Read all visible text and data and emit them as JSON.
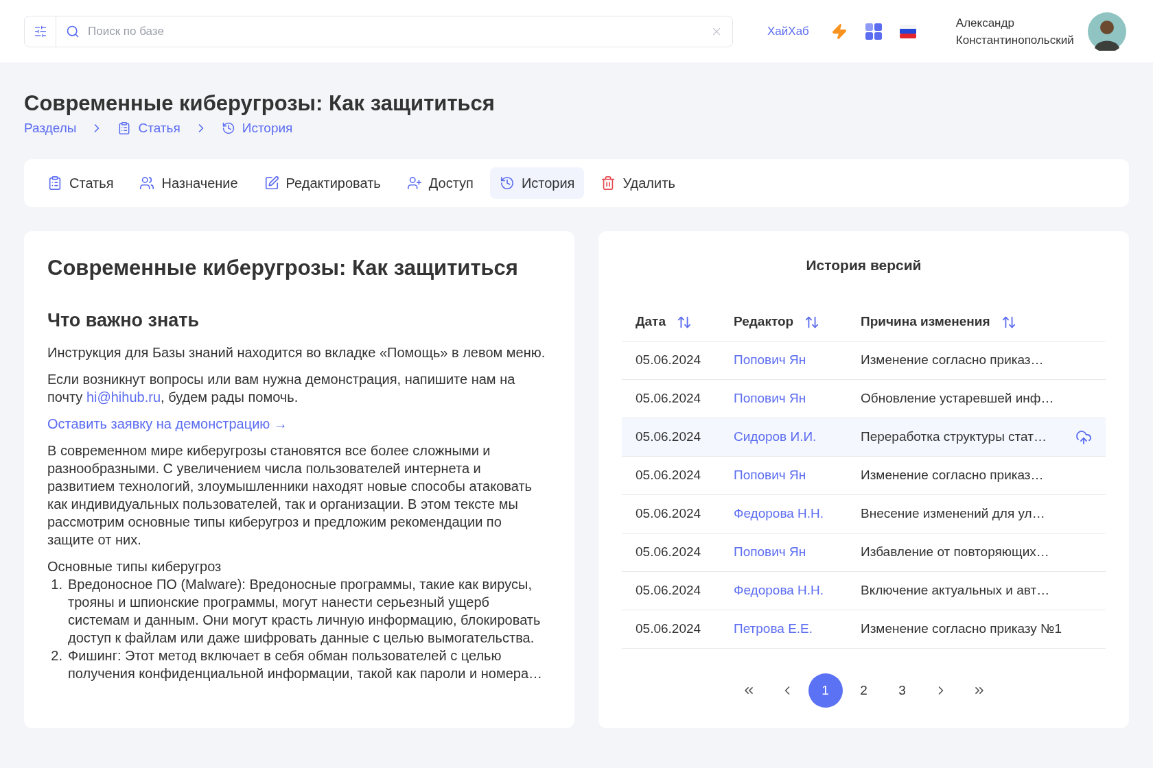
{
  "header": {
    "search": {
      "placeholder": "Поиск по базе"
    },
    "brand_link": "ХайХаб",
    "user": {
      "first_name": "Александр",
      "last_name": "Константинопольский"
    }
  },
  "page": {
    "title": "Современные киберугрозы: Как защититься",
    "breadcrumbs": [
      {
        "label": "Разделы"
      },
      {
        "label": "Статья"
      },
      {
        "label": "История"
      }
    ]
  },
  "tabs": [
    {
      "label": "Статья",
      "selected": false
    },
    {
      "label": "Назначение",
      "selected": false
    },
    {
      "label": "Редактировать",
      "selected": false
    },
    {
      "label": "Доступ",
      "selected": false
    },
    {
      "label": "История",
      "selected": true
    },
    {
      "label": "Удалить",
      "selected": false
    }
  ],
  "article": {
    "title": "Современные киберугрозы: Как защититься",
    "subtitle": "Что важно знать",
    "blocks": [
      {
        "kind": "paragraph",
        "text": "Инструкция для Базы знаний находится во вкладке «Помощь» в левом меню."
      },
      {
        "kind": "email_paragraph",
        "before": "Если возникнут вопросы или вам нужна демонстрация, напишите нам на почту ",
        "link": "hi@hihub.ru",
        "after": ", будем рады помочь."
      },
      {
        "kind": "link",
        "text": "Оставить заявку на демонстрацию →"
      },
      {
        "kind": "paragraph",
        "text": "В современном мире киберугрозы становятся все более сложными и разнообразными. С увеличением числа пользователей интернета и развитием технологий, злоумышленники находят новые способы атаковать как индивидуальных пользователей, так и организации. В этом тексте мы рассмотрим основные типы киберугроз и предложим рекомендации по защите от них."
      },
      {
        "kind": "list",
        "heading": "Основные типы киберугроз",
        "items": [
          {
            "number": "1.",
            "text": "Вредоносное ПО (Malware): Вредоносные программы, такие как вирусы, трояны и шпионские программы, могут нанести серьезный ущерб системам и данным. Они могут красть личную информацию, блокировать доступ к файлам или даже шифровать данные с целью вымогательства."
          },
          {
            "number": "2.",
            "text": "Фишинг: Этот метод включает в себя обман пользователей с целью получения конфиденциальной информации, такой как пароли и номера…"
          }
        ]
      }
    ]
  },
  "history": {
    "title": "История версий",
    "columns": [
      "Дата",
      "Редактор",
      "Причина изменения"
    ],
    "rows": [
      {
        "date": "05.06.2024",
        "editor": "Попович Ян",
        "reason": "Изменение согласно приказ…",
        "selected": false
      },
      {
        "date": "05.06.2024",
        "editor": "Попович Ян",
        "reason": "Обновление устаревшей инф…",
        "selected": false
      },
      {
        "date": "05.06.2024",
        "editor": "Сидоров И.И.",
        "reason": "Переработка структуры стат…",
        "selected": true
      },
      {
        "date": "05.06.2024",
        "editor": "Попович Ян",
        "reason": "Изменение согласно приказ…",
        "selected": false
      },
      {
        "date": "05.06.2024",
        "editor": "Федорова Н.Н.",
        "reason": "Внесение изменений для ул…",
        "selected": false
      },
      {
        "date": "05.06.2024",
        "editor": "Попович Ян",
        "reason": "Избавление от повторяющих…",
        "selected": false
      },
      {
        "date": "05.06.2024",
        "editor": "Федорова Н.Н.",
        "reason": "Включение актуальных и авт…",
        "selected": false
      },
      {
        "date": "05.06.2024",
        "editor": "Петрова Е.Е.",
        "reason": "Изменение согласно приказу №1",
        "selected": false
      }
    ],
    "pagination": [
      {
        "label": "1",
        "selected": true
      },
      {
        "label": "2",
        "selected": false
      },
      {
        "label": "3",
        "selected": false
      }
    ]
  }
}
